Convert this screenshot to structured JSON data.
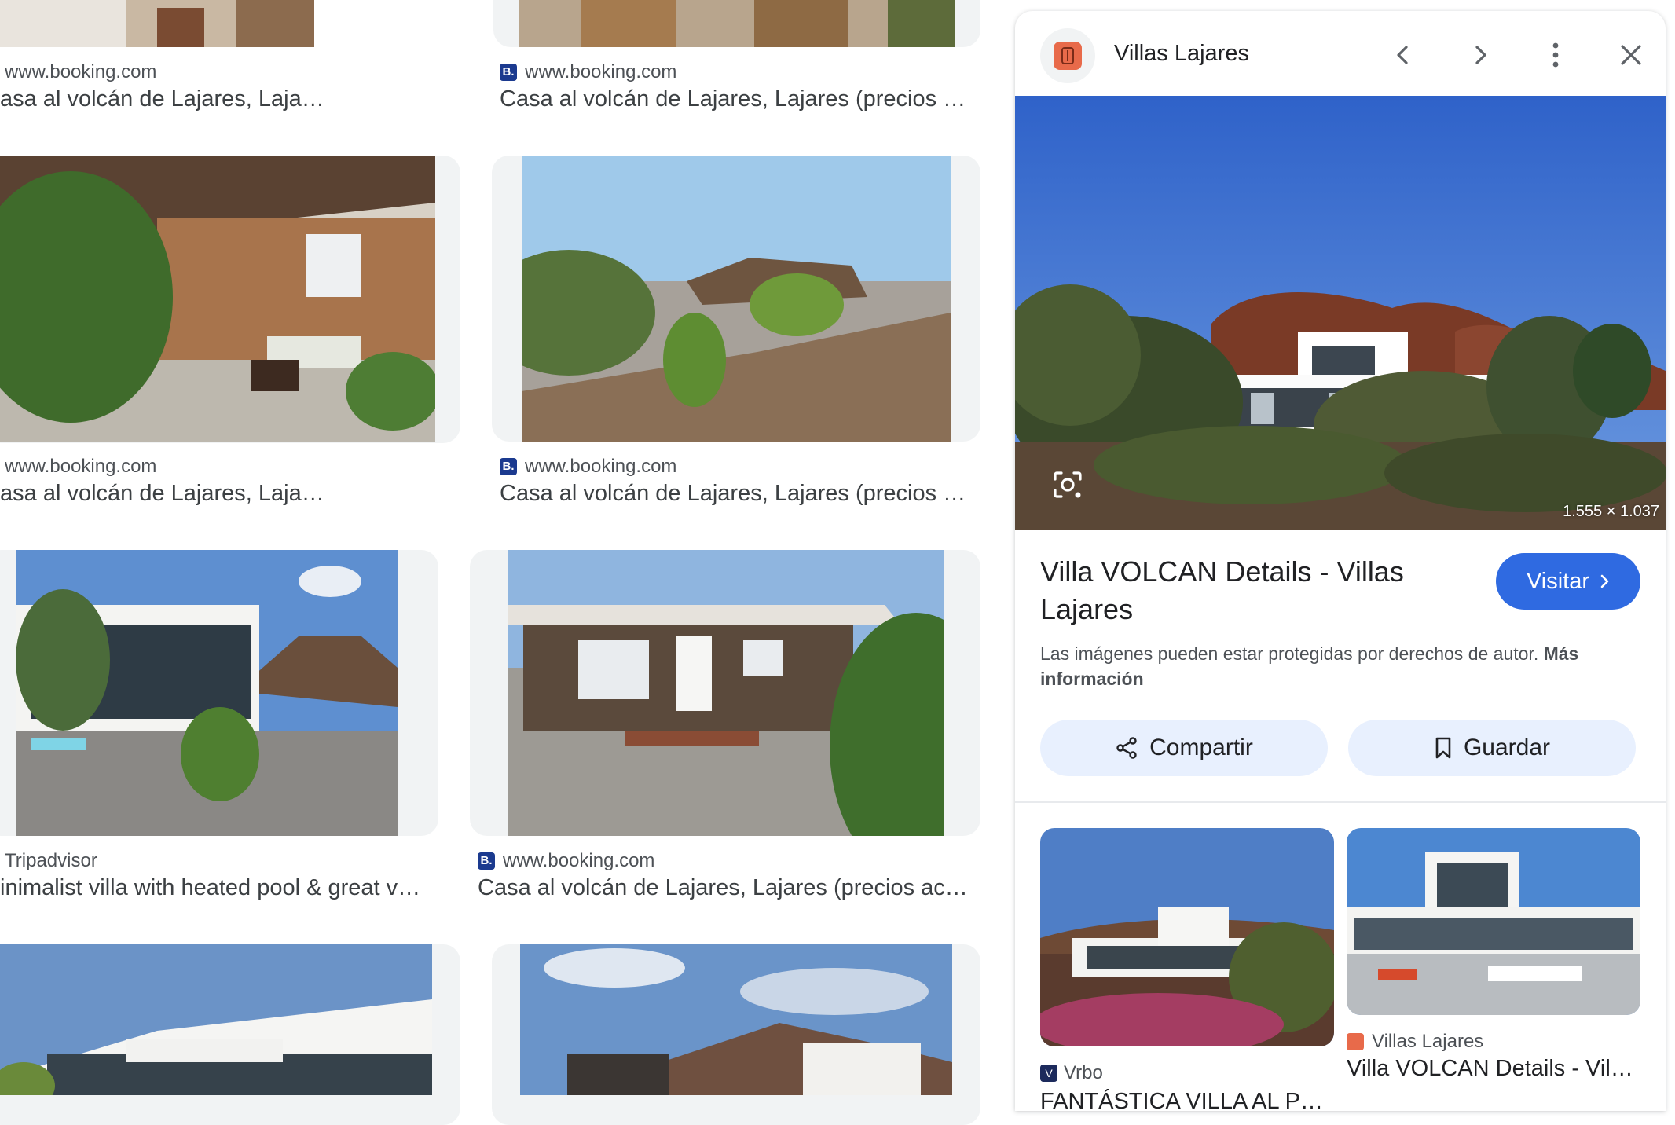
{
  "grid": {
    "rows": [
      {
        "left": {
          "source": "www.booking.com",
          "title": "asa al volcán de Lajares, Lajares (precios …",
          "favicon": ""
        },
        "right": {
          "source": "www.booking.com",
          "title": "Casa al volcán de Lajares, Lajares (precios …",
          "favicon": "B."
        }
      },
      {
        "left": {
          "source": "www.booking.com",
          "title": "asa al volcán de Lajares, Lajares (precios …",
          "favicon": ""
        },
        "right": {
          "source": "www.booking.com",
          "title": "Casa al volcán de Lajares, Lajares (precios …",
          "favicon": "B."
        }
      },
      {
        "left": {
          "source": "Tripadvisor",
          "title": "inimalist villa with heated pool & great v…",
          "favicon": ""
        },
        "right": {
          "source": "www.booking.com",
          "title": "Casa al volcán de Lajares, Lajares (precios ac…",
          "favicon": "B."
        }
      }
    ]
  },
  "panel": {
    "site_name": "Villas Lajares",
    "dimensions": "1.555 × 1.037",
    "page_title": "Villa VOLCAN Details - Villas Lajares",
    "visit_label": "Visitar",
    "copyright_text": "Las imágenes pueden estar protegidas por derechos de autor.",
    "copyright_link": "Más información",
    "share_label": "Compartir",
    "save_label": "Guardar",
    "related": [
      {
        "source": "Vrbo",
        "favicon": "V",
        "title": "FANTÁSTICA VILLA AL P…"
      },
      {
        "source": "Villas Lajares",
        "favicon": "",
        "title": "Villa VOLCAN Details - Vil…"
      }
    ]
  },
  "colors": {
    "accent": "#1a73e8",
    "visit_button": "#2f6ae1",
    "chip_bg": "#e8f0fe",
    "booking_blue": "#1b3a8f"
  },
  "icons": [
    "back-icon",
    "forward-icon",
    "more-vert-icon",
    "close-icon",
    "lens-icon",
    "share-icon",
    "bookmark-icon",
    "chevron-right-icon"
  ]
}
